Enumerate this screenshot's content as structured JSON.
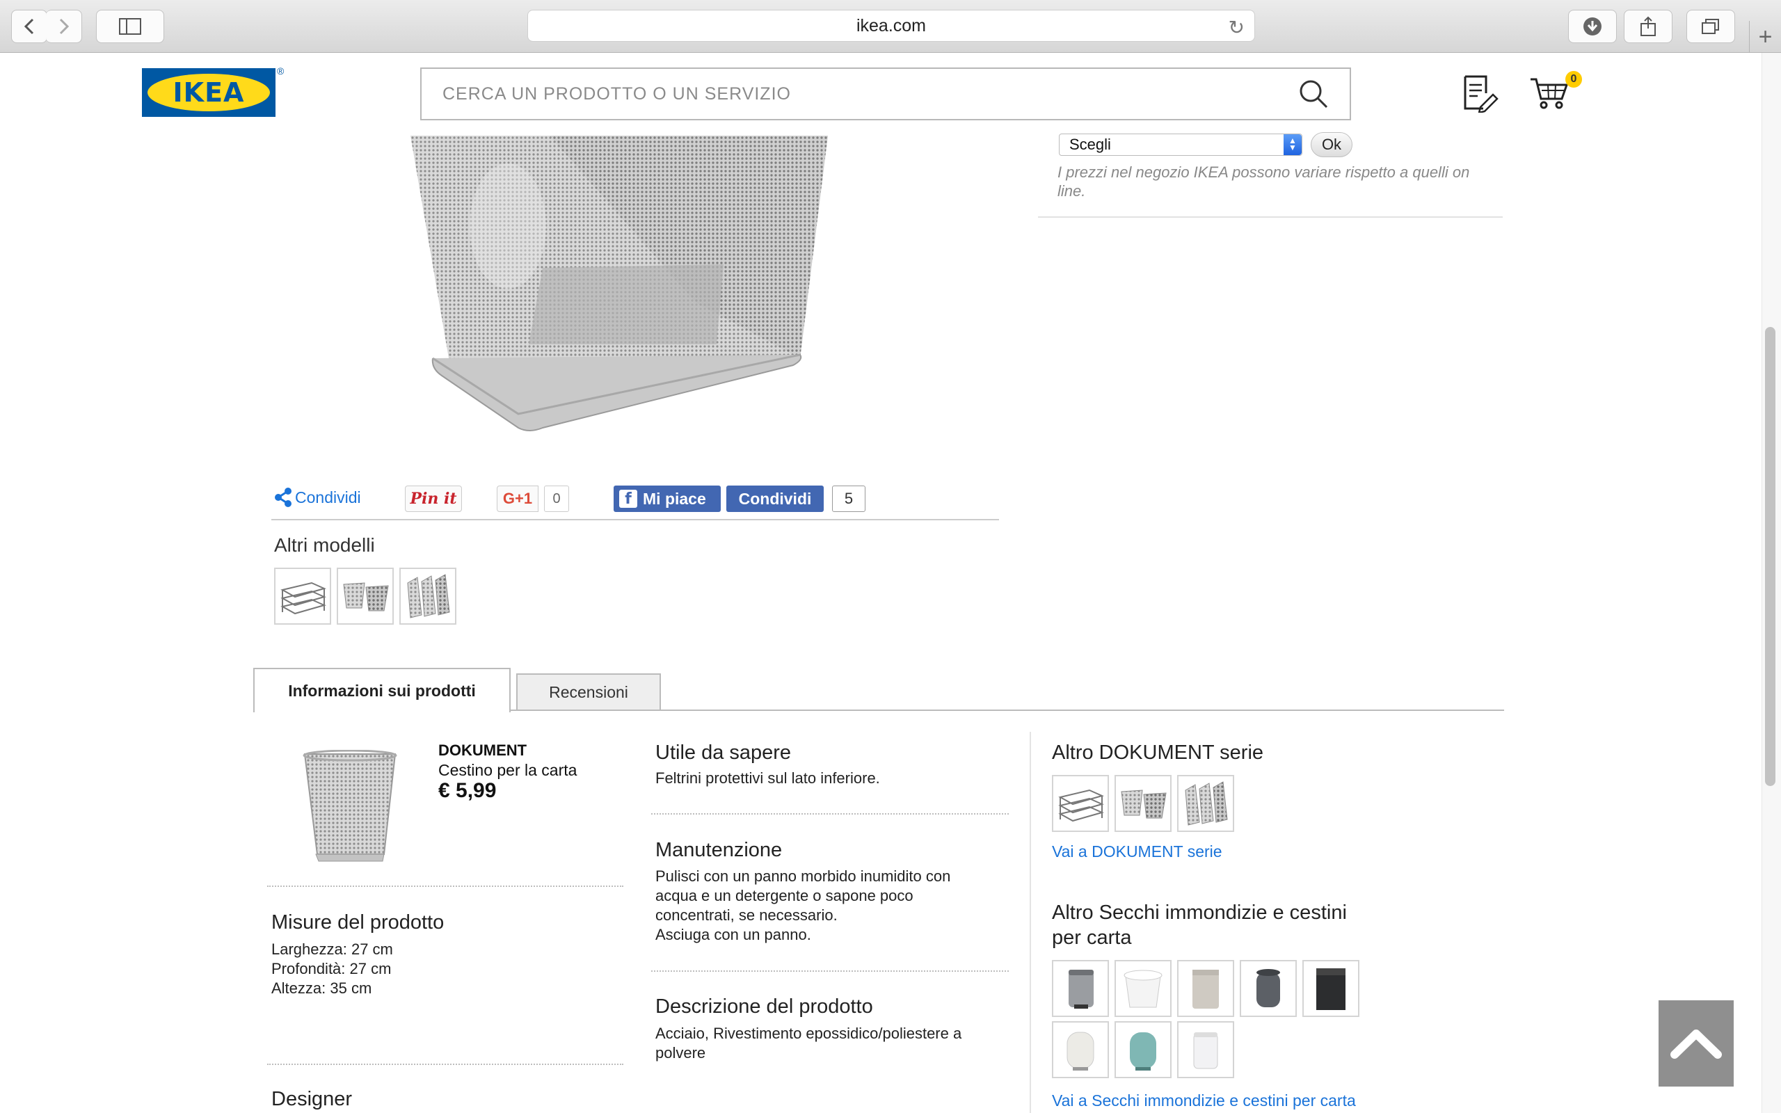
{
  "browser": {
    "url": "ikea.com",
    "back_icon": "chevron-left-icon",
    "forward_icon": "chevron-right-icon"
  },
  "header": {
    "logo_text": "IKEA",
    "logo_reg": "®",
    "search_placeholder": "CERCA UN PRODOTTO O UN SERVIZIO",
    "cart_count": "0",
    "brand_blue": "#0058a3",
    "brand_yellow": "#ffda1a"
  },
  "store": {
    "select_value": "Scegli",
    "ok_label": "Ok",
    "price_note": "I prezzi nel negozio IKEA possono variare rispetto a quelli on line."
  },
  "share": {
    "condividi": "Condividi",
    "pinit": "Pin it",
    "gplus": "G+1",
    "gplus_count": "0",
    "fb_like": "Mi piace",
    "fb_share": "Condividi",
    "fb_count": "5"
  },
  "altri_modelli": {
    "title": "Altri modelli"
  },
  "tabs": {
    "info": "Informazioni sui prodotti",
    "reviews": "Recensioni"
  },
  "product": {
    "name": "DOKUMENT",
    "type": "Cestino per la carta",
    "price": "€ 5,99"
  },
  "misure": {
    "title": "Misure del prodotto",
    "lines": [
      "Larghezza: 27 cm",
      "Profondità: 27 cm",
      "Altezza: 35 cm"
    ]
  },
  "designer": {
    "title": "Designer"
  },
  "utile": {
    "title": "Utile da sapere",
    "text": "Feltrini protettivi sul lato inferiore."
  },
  "manutenzione": {
    "title": "Manutenzione",
    "lines": [
      "Pulisci con un panno morbido inumidito con",
      "acqua e un detergente o sapone poco",
      "concentrati, se necessario.",
      "Asciuga con un panno."
    ]
  },
  "descrizione": {
    "title": "Descrizione del prodotto",
    "lines": [
      "Acciaio, Rivestimento epossidico/poliestere a",
      "polvere"
    ]
  },
  "serie": {
    "title": "Altro DOKUMENT serie",
    "link": "Vai a DOKUMENT serie"
  },
  "secchi": {
    "title_lines": [
      "Altro Secchi immondizie e cestini",
      "per carta"
    ],
    "link": "Vai a Secchi immondizie e cestini per carta"
  }
}
